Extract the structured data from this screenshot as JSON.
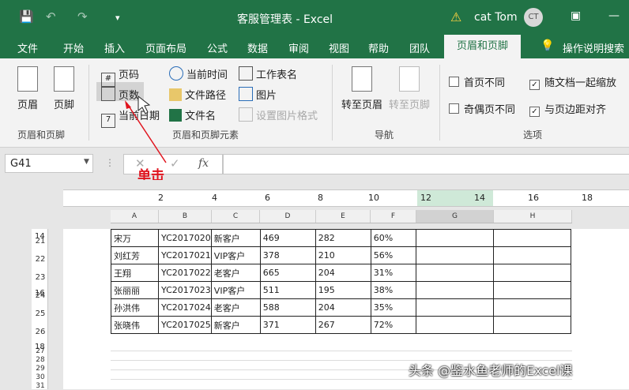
{
  "window": {
    "title": "客服管理表 - Excel",
    "user": "cat Tom",
    "avatar": "CT"
  },
  "menu": {
    "tabs": [
      "文件",
      "开始",
      "插入",
      "页面布局",
      "公式",
      "数据",
      "审阅",
      "视图",
      "帮助",
      "团队",
      "页眉和页脚"
    ],
    "active": "页眉和页脚",
    "search": "操作说明搜索"
  },
  "ribbon": {
    "header_label": "页眉",
    "footer_label": "页脚",
    "group1": "页眉和页脚",
    "page_number": "页码",
    "page_count": "页数",
    "current_date": "当前日期",
    "current_time": "当前时间",
    "file_path": "文件路径",
    "file_name": "文件名",
    "sheet_name": "工作表名",
    "picture": "图片",
    "format_picture": "设置图片格式",
    "group2": "页眉和页脚元素",
    "goto_header": "转至页眉",
    "goto_footer": "转至页脚",
    "group3": "导航",
    "diff_first": "首页不同",
    "diff_odd_even": "奇偶页不同",
    "scale_with_doc": "随文档一起缩放",
    "align_margins": "与页边距对齐",
    "group4": "选项"
  },
  "formula_bar": {
    "name_box": "G41",
    "fx": "fx"
  },
  "annotation": "单击",
  "columns": [
    "A",
    "B",
    "C",
    "D",
    "E",
    "F",
    "G",
    "H"
  ],
  "ruler_marks": [
    "2",
    "4",
    "6",
    "8",
    "10",
    "12",
    "14",
    "16",
    "18"
  ],
  "left_ruler_marks": [
    "14",
    "16",
    "18"
  ],
  "rows": [
    {
      "num": "21",
      "cells": [
        "宋万",
        "YC2017020",
        "新客户",
        "469",
        "282",
        "60%"
      ]
    },
    {
      "num": "22",
      "cells": [
        "刘红芳",
        "YC2017021",
        "VIP客户",
        "378",
        "210",
        "56%"
      ]
    },
    {
      "num": "23",
      "cells": [
        "王翔",
        "YC2017022",
        "老客户",
        "665",
        "204",
        "31%"
      ]
    },
    {
      "num": "24",
      "cells": [
        "张丽丽",
        "YC2017023",
        "VIP客户",
        "511",
        "195",
        "38%"
      ]
    },
    {
      "num": "25",
      "cells": [
        "孙洪伟",
        "YC2017024",
        "老客户",
        "588",
        "204",
        "35%"
      ]
    },
    {
      "num": "26",
      "cells": [
        "张晓伟",
        "YC2017025",
        "新客户",
        "371",
        "267",
        "72%"
      ]
    }
  ],
  "empty_rows": [
    "27",
    "28",
    "29",
    "30",
    "31"
  ],
  "watermark": "头条 @鉴水鱼老师的Excel课",
  "colors": {
    "excel_green": "#217346",
    "annotation_red": "#e0141e"
  }
}
